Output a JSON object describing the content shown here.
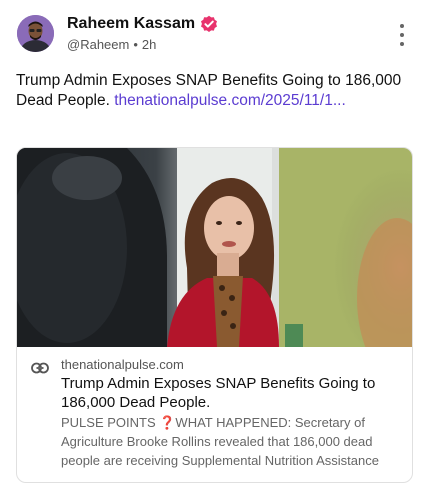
{
  "author": {
    "display_name": "Raheem Kassam",
    "handle": "@Raheem",
    "separator": "•",
    "time_ago": "2h",
    "avatar_icon": "person-avatar-icon",
    "verified_icon": "verified-badge-icon",
    "verified_color": "#e8336d"
  },
  "post": {
    "text": "Trump Admin Exposes SNAP Benefits Going to 186,000 Dead People. ",
    "link_text": "thenationalpulse.com/​2025/11/1...",
    "link_color": "#5b3cd1"
  },
  "card": {
    "domain": "thenationalpulse.com",
    "title": "Trump Admin Exposes SNAP Benefits Going to 186,000 Dead People.",
    "description": "PULSE POINTS ❓WHAT HAPPENED: Secretary of Agriculture Brooke Rollins revealed that 186,000 dead people are receiving Supplemental Nutrition Assistance",
    "link_icon": "link-icon",
    "image_icon": "article-photo"
  },
  "menu_icon": "more-options-icon"
}
